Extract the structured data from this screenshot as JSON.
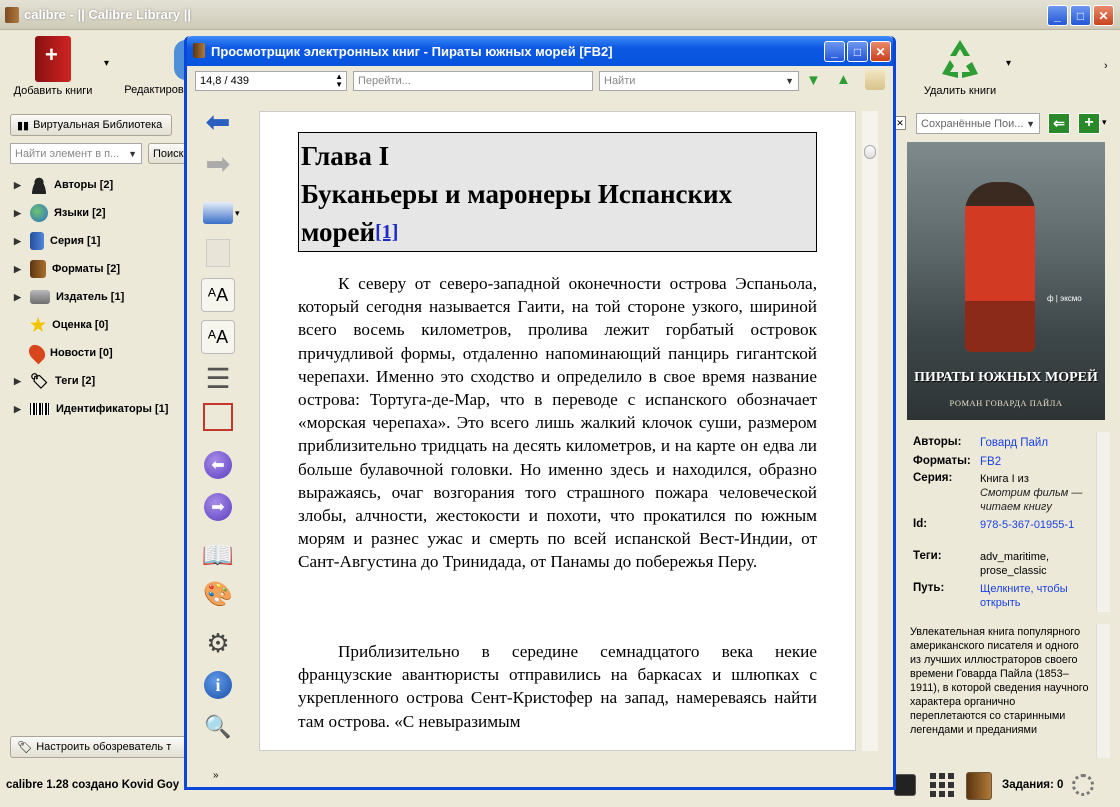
{
  "main_window": {
    "title": "calibre - || Calibre Library ||",
    "title_buttons": {
      "minimize": "_",
      "maximize": "□",
      "close": "✕"
    }
  },
  "toolbar": {
    "add_books": "Добавить книги",
    "edit": "Редактиров",
    "remove_books": "Удалить книги"
  },
  "left_panel": {
    "virtual_library": "Виртуальная Библиотека",
    "find_item_placeholder": "Найти элемент в п...",
    "search_button": "Поиск",
    "tree": [
      {
        "label": "Авторы [2]",
        "expandable": true,
        "icon": "person-icon"
      },
      {
        "label": "Языки [2]",
        "expandable": true,
        "icon": "globe-icon"
      },
      {
        "label": "Серия [1]",
        "expandable": true,
        "icon": "series-icon"
      },
      {
        "label": "Форматы [2]",
        "expandable": true,
        "icon": "book-icon"
      },
      {
        "label": "Издатель [1]",
        "expandable": true,
        "icon": "publisher-icon"
      },
      {
        "label": "Оценка [0]",
        "expandable": false,
        "icon": "star-icon"
      },
      {
        "label": "Новости [0]",
        "expandable": false,
        "icon": "news-icon"
      },
      {
        "label": "Теги [2]",
        "expandable": true,
        "icon": "tag-icon"
      },
      {
        "label": "Идентификаторы [1]",
        "expandable": true,
        "icon": "barcode-icon"
      }
    ],
    "configure_browser": "Настроить обозреватель т"
  },
  "status_bar": {
    "left": "calibre 1.28 создано Kovid Goy",
    "jobs": "Задания: 0"
  },
  "viewer": {
    "title": "Просмотрщик электронных книг - Пираты южных морей [FB2]",
    "title_buttons": {
      "minimize": "_",
      "maximize": "□",
      "close": "✕"
    },
    "position": "14,8 / 439",
    "goto_placeholder": "Перейти...",
    "find_placeholder": "Найти",
    "heading_line1": "Глава I",
    "heading_line2": "Буканьеры и маронеры Испанских морей",
    "footnote": "[1]",
    "para1": "К северу от северо-западной оконечности острова Эспаньола, который сегодня называется Гаити, на той стороне узкого, шириной всего восемь километров, пролива лежит горбатый островок причудливой формы, отдаленно напоминающий панцирь гигантской черепахи. Именно это сходство и определило в свое время название острова: Тортуга-де-Мар, что в переводе с испанского обозначает «морская черепаха». Это всего лишь жалкий клочок суши, размером приблизительно тридцать на десять километров, и на карте он едва ли больше булавочной головки. Но именно здесь и находился, образно выражаясь, очаг возгорания того страшного пожара человеческой злобы, алчности, жестокости и похоти, что прокатился по южным морям и разнес ужас и смерть по всей испанской Вест-Индии, от Сант-Августина до Тринидада, от Панамы до побережья Перу.",
    "para2": "Приблизительно в середине семнадцатого века некие французские авантюристы отправились на баркасах и шлюпках с укрепленного острова Сент-Кристофер на запад, намереваясь найти там острова. «С невыразимым"
  },
  "right_panel": {
    "saved_searches": "Сохранённые Пои...",
    "cover_title": "ПИРАТЫ ЮЖНЫХ МОРЕЙ",
    "cover_subtitle": "РОМАН ГОВАРДА ПАЙЛА",
    "cover_publisher": "ф | эксмо",
    "meta": {
      "authors_label": "Авторы:",
      "authors_value": "Говард Пайл",
      "formats_label": "Форматы:",
      "formats_value": "FB2",
      "series_label": "Серия:",
      "series_prefix": "Книга I из",
      "series_value": "Смотрим фильм — читаем книгу",
      "id_label": "Id:",
      "id_value": "978-5-367-01955-1",
      "tags_label": "Теги:",
      "tags_value": "adv_maritime, prose_classic",
      "path_label": "Путь:",
      "path_value": "Щелкните, чтобы открыть"
    },
    "description": "Увлекательная книга популярного американского писателя и одного из лучших иллюстраторов своего времени Говарда Пайла (1853–1911), в которой сведения научного характера органично переплетаются со старинными легендами и преданиями"
  },
  "colors": {
    "xp_blue": "#0a46d8",
    "link": "#1a3fe6",
    "cover_red": "#c8321e"
  }
}
